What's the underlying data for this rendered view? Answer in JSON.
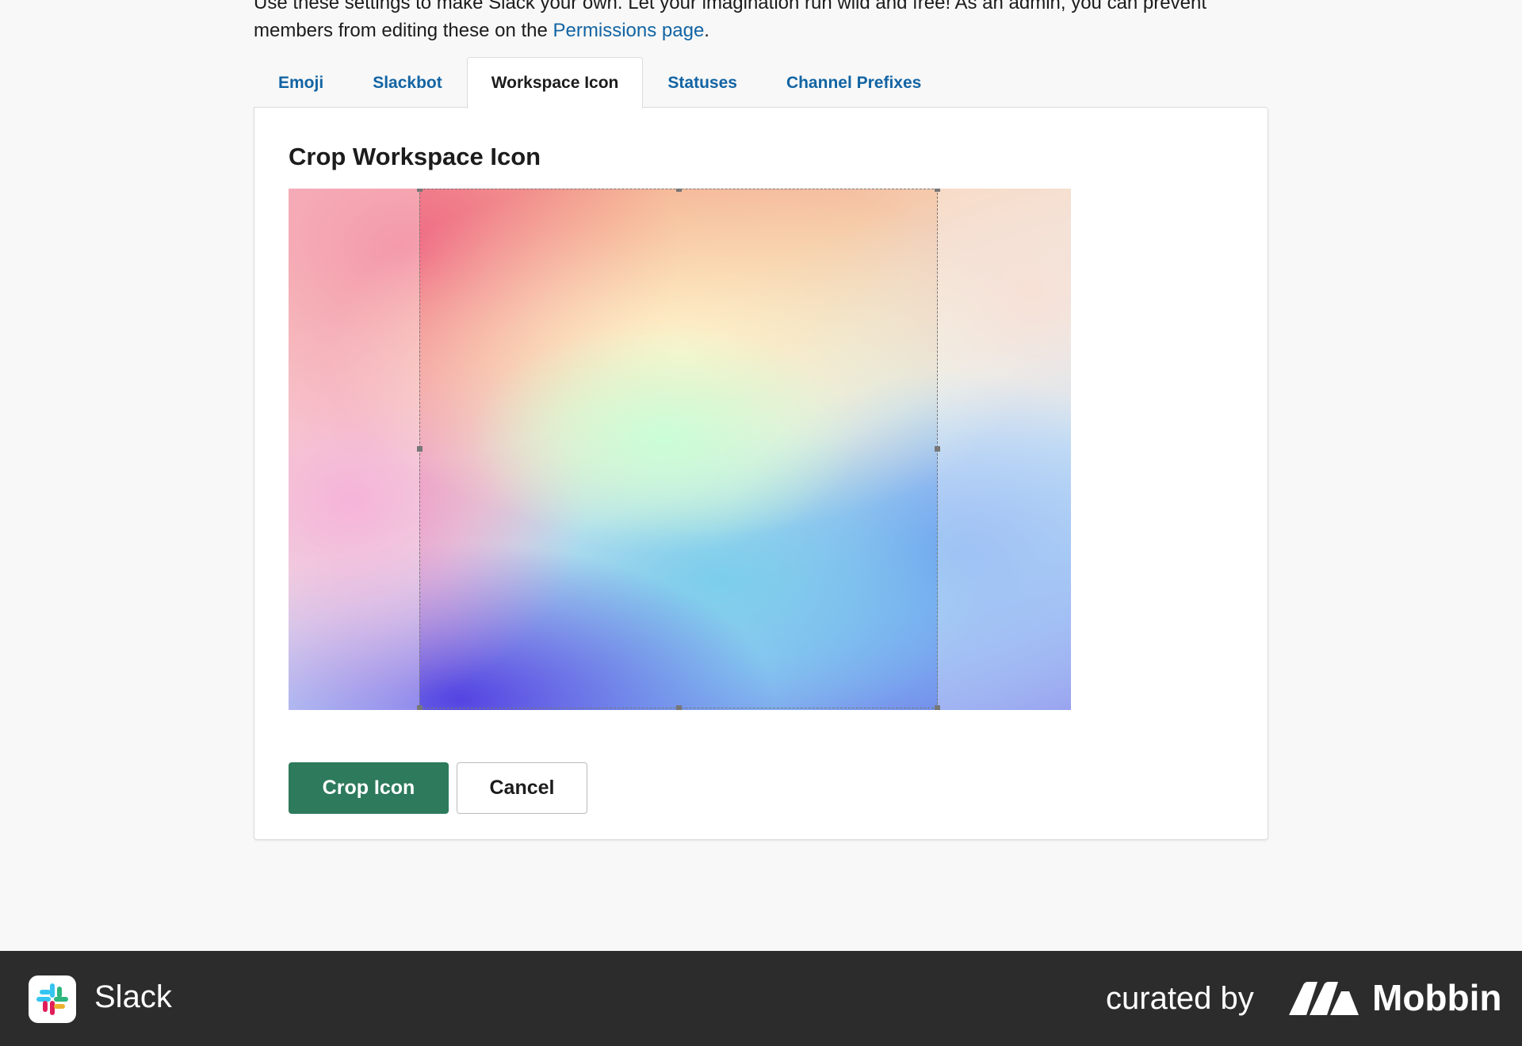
{
  "intro": {
    "text_before": "Use these settings to make Slack your own. Let your imagination run wild and free! As an admin, you can prevent members from editing these on the ",
    "link": "Permissions page",
    "text_after": "."
  },
  "tabs": [
    {
      "label": "Emoji",
      "active": false
    },
    {
      "label": "Slackbot",
      "active": false
    },
    {
      "label": "Workspace Icon",
      "active": true
    },
    {
      "label": "Statuses",
      "active": false
    },
    {
      "label": "Channel Prefixes",
      "active": false
    }
  ],
  "panel": {
    "title": "Crop Workspace Icon",
    "crop_button": "Crop Icon",
    "cancel_button": "Cancel"
  },
  "footer": {
    "app_name": "Slack",
    "curated_by": "curated by",
    "brand": "Mobbin"
  },
  "colors": {
    "link": "#1264a3",
    "primary_button": "#2d7a5c",
    "footer_bg": "#2c2c2c"
  },
  "icons": [
    "slack-logo-icon",
    "mobbin-logo-icon"
  ]
}
